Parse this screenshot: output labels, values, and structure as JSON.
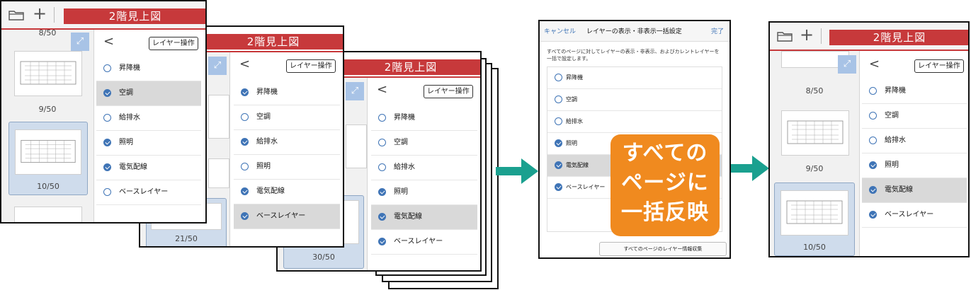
{
  "common": {
    "title": "2階見上図",
    "layer_op_button": "レイヤー操作",
    "back_glyph": "<",
    "folder_icon": "folder-icon",
    "plus_glyph": "+",
    "expand_glyph": "⤢"
  },
  "screen1": {
    "top_page_label": "8/50",
    "pages": [
      "9/50",
      "10/50"
    ],
    "layers": [
      {
        "label": "昇降機",
        "checked": false,
        "selected": false
      },
      {
        "label": "空調",
        "checked": true,
        "selected": true
      },
      {
        "label": "給排水",
        "checked": false,
        "selected": false
      },
      {
        "label": "照明",
        "checked": true,
        "selected": false
      },
      {
        "label": "電気配線",
        "checked": true,
        "selected": false
      },
      {
        "label": "ベースレイヤー",
        "checked": false,
        "selected": false
      }
    ]
  },
  "screen2": {
    "page": "21/50",
    "layers": [
      {
        "label": "昇降機",
        "checked": true,
        "selected": false
      },
      {
        "label": "空調",
        "checked": false,
        "selected": false
      },
      {
        "label": "給排水",
        "checked": true,
        "selected": false
      },
      {
        "label": "照明",
        "checked": false,
        "selected": false
      },
      {
        "label": "電気配線",
        "checked": true,
        "selected": false
      },
      {
        "label": "ベースレイヤー",
        "checked": true,
        "selected": true
      }
    ]
  },
  "screen3": {
    "page": "30/50",
    "layers": [
      {
        "label": "昇降機",
        "checked": false,
        "selected": false
      },
      {
        "label": "空調",
        "checked": false,
        "selected": false
      },
      {
        "label": "給排水",
        "checked": false,
        "selected": false
      },
      {
        "label": "照明",
        "checked": true,
        "selected": false
      },
      {
        "label": "電気配線",
        "checked": true,
        "selected": true
      },
      {
        "label": "ベースレイヤー",
        "checked": true,
        "selected": false
      }
    ]
  },
  "dialog": {
    "cancel": "キャンセル",
    "title": "レイヤーの表示・非表示一括設定",
    "done": "完了",
    "description": "すべてのページに対してレイヤーの表示・非表示、およびカレントレイヤーを一括で設定します。",
    "layers": [
      {
        "label": "昇降機",
        "checked": false,
        "selected": false
      },
      {
        "label": "空調",
        "checked": false,
        "selected": false
      },
      {
        "label": "給排水",
        "checked": false,
        "selected": false
      },
      {
        "label": "照明",
        "checked": true,
        "selected": false
      },
      {
        "label": "電気配線",
        "checked": true,
        "selected": true
      },
      {
        "label": "ベースレイヤー",
        "checked": true,
        "selected": false
      }
    ],
    "collect_button": "すべてのページのレイヤー情報収集"
  },
  "callout": {
    "line1": "すべての",
    "line2": "ページに",
    "line3": "一括反映"
  },
  "result": {
    "pages": [
      "8/50",
      "9/50",
      "10/50"
    ],
    "layers": [
      {
        "label": "昇降機",
        "checked": false,
        "selected": false
      },
      {
        "label": "空調",
        "checked": false,
        "selected": false
      },
      {
        "label": "給排水",
        "checked": false,
        "selected": false
      },
      {
        "label": "照明",
        "checked": true,
        "selected": false
      },
      {
        "label": "電気配線",
        "checked": true,
        "selected": true
      },
      {
        "label": "ベースレイヤー",
        "checked": true,
        "selected": false
      }
    ]
  },
  "colors": {
    "accent_red": "#c7393b",
    "check_blue": "#3f74b6",
    "arrow_teal": "#1aa08f",
    "callout_orange": "#f08a1f"
  }
}
